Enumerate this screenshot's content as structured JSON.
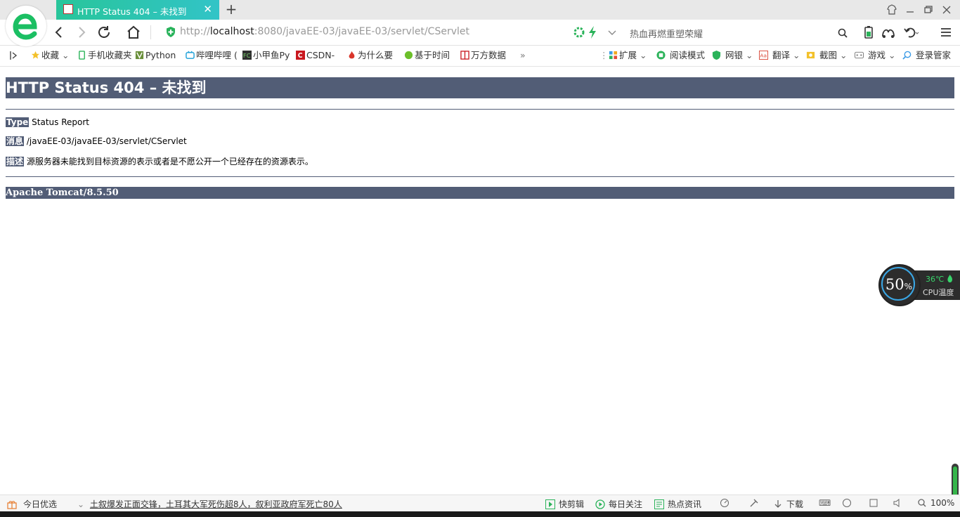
{
  "browser": {
    "tab": {
      "title": "HTTP Status 404 – 未找到",
      "close": "✕"
    },
    "new_tab": "+",
    "url_prefix": "http://",
    "url_host": "localhost",
    "url_rest": ":8080/javaEE-03/javaEE-03/servlet/CServlet",
    "search_placeholder": "热血再燃重塑荣耀",
    "bookmarks": [
      "收藏",
      "手机收藏夹",
      "Python",
      "哔哩哔哩 (",
      "小甲鱼Py",
      "CSDN-",
      "为什么要",
      "基于时间",
      "万方数据"
    ],
    "more": "»",
    "tools": [
      "扩展",
      "阅读模式",
      "网银",
      "翻译",
      "截图",
      "游戏",
      "登录管家"
    ]
  },
  "page": {
    "heading": "HTTP Status 404 – 未找到",
    "type_label": "Type",
    "type_value": "Status Report",
    "message_label": "消息",
    "message_value": "/javaEE-03/javaEE-03/servlet/CServlet",
    "desc_label": "描述",
    "desc_value": "源服务器未能找到目标资源的表示或者是不愿公开一个已经存在的资源表示。",
    "footer": "Apache Tomcat/8.5.50"
  },
  "cpu_widget": {
    "percent": "50",
    "percent_sign": "%",
    "temp": "36℃",
    "label": "CPU温度"
  },
  "statusbar": {
    "today": "今日优选",
    "news": "土叙爆发正面交锋，土耳其大军死伤超8人，叙利亚政府军死亡80人",
    "quick_edit": "快剪辑",
    "daily": "每日关注",
    "hot": "热点资讯",
    "download": "下载",
    "zoom": "100%"
  },
  "colors": {
    "tomcat": "#525d76",
    "tab": "#2ac1a4"
  }
}
